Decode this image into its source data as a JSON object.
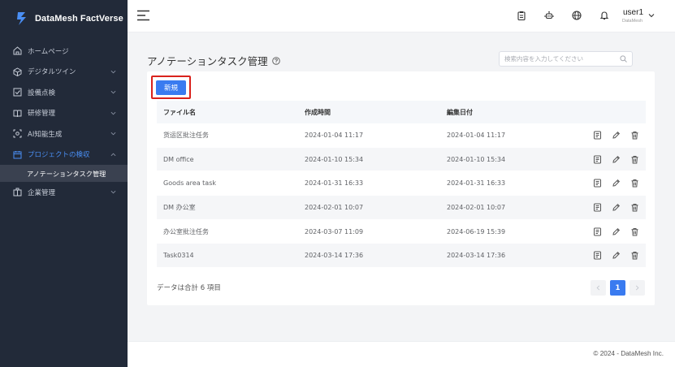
{
  "brand": {
    "name": "DataMesh FactVerse"
  },
  "sidebar": {
    "items": [
      {
        "label": "ホームページ",
        "icon": "home-icon",
        "has_children": false
      },
      {
        "label": "デジタルツイン",
        "icon": "cube-icon",
        "has_children": true
      },
      {
        "label": "設備点検",
        "icon": "checkbox-icon",
        "has_children": true
      },
      {
        "label": "研修管理",
        "icon": "book-icon",
        "has_children": true
      },
      {
        "label": "AI知能生成",
        "icon": "ai-icon",
        "has_children": true
      },
      {
        "label": "プロジェクトの検収",
        "icon": "calendar-icon",
        "has_children": true,
        "active": true
      },
      {
        "label": "企業管理",
        "icon": "building-icon",
        "has_children": true
      }
    ],
    "sub_active": "アノテーションタスク管理"
  },
  "header": {
    "user_name": "user1",
    "user_org": "DataMesh",
    "icons": [
      "clipboard-icon",
      "robot-icon",
      "globe-icon",
      "bell-icon"
    ]
  },
  "page": {
    "title": "アノテーションタスク管理",
    "search_placeholder": "検索内容を入力してください",
    "new_button": "新規"
  },
  "table": {
    "columns": [
      "ファイル名",
      "作成時間",
      "編集日付",
      ""
    ],
    "rows": [
      {
        "name": "货运区批注任务",
        "created": "2024-01-04 11:17",
        "edited": "2024-01-04 11:17"
      },
      {
        "name": "DM office",
        "created": "2024-01-10 15:34",
        "edited": "2024-01-10 15:34"
      },
      {
        "name": "Goods area task",
        "created": "2024-01-31 16:33",
        "edited": "2024-01-31 16:33"
      },
      {
        "name": "DM 办公室",
        "created": "2024-02-01 10:07",
        "edited": "2024-02-01 10:07"
      },
      {
        "name": "办公室批注任务",
        "created": "2024-03-07 11:09",
        "edited": "2024-06-19 15:39"
      },
      {
        "name": "Task0314",
        "created": "2024-03-14 17:36",
        "edited": "2024-03-14 17:36"
      }
    ]
  },
  "pagination": {
    "total_text": "データは合計 6 項目",
    "prev": "‹",
    "current": "1",
    "next": "›"
  },
  "footer": {
    "copyright": "© 2024 - DataMesh Inc."
  },
  "colors": {
    "sidebar_bg": "#222a39",
    "accent": "#3a7bf0",
    "highlight_border": "#d9221c"
  }
}
